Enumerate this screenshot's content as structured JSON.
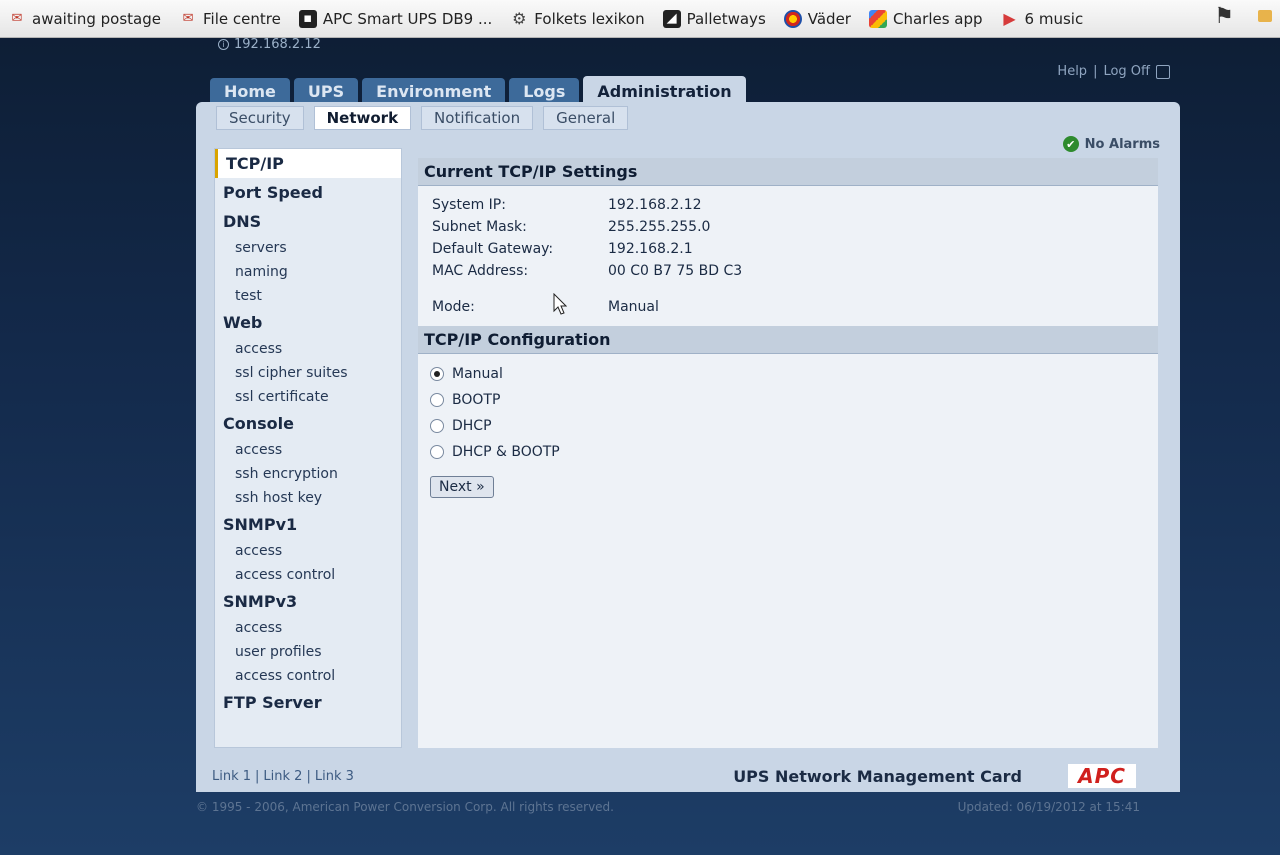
{
  "bookmarks": [
    {
      "label": "awaiting postage",
      "icon": "ebay-icon"
    },
    {
      "label": "File centre",
      "icon": "ebay-icon"
    },
    {
      "label": "APC Smart UPS DB9 ...",
      "icon": "apc-icon"
    },
    {
      "label": "Folkets lexikon",
      "icon": "gear-icon"
    },
    {
      "label": "Palletways",
      "icon": "palletways-icon"
    },
    {
      "label": "Väder",
      "icon": "sun-icon"
    },
    {
      "label": "Charles app",
      "icon": "google-icon"
    },
    {
      "label": "6 music",
      "icon": "play-icon"
    }
  ],
  "header": {
    "ip": "192.168.2.12",
    "help": "Help",
    "separator": "|",
    "logoff": "Log Off"
  },
  "main_tabs": [
    {
      "label": "Home"
    },
    {
      "label": "UPS"
    },
    {
      "label": "Environment"
    },
    {
      "label": "Logs"
    },
    {
      "label": "Administration",
      "active": true
    }
  ],
  "sub_tabs": [
    {
      "label": "Security"
    },
    {
      "label": "Network",
      "active": true
    },
    {
      "label": "Notification"
    },
    {
      "label": "General"
    }
  ],
  "status": {
    "alarms": "No Alarms"
  },
  "sidenav": [
    {
      "label": "TCP/IP",
      "level": 1,
      "current": true
    },
    {
      "label": "Port Speed",
      "level": 1
    },
    {
      "label": "DNS",
      "level": 1
    },
    {
      "label": "servers",
      "level": 2
    },
    {
      "label": "naming",
      "level": 2
    },
    {
      "label": "test",
      "level": 2
    },
    {
      "label": "Web",
      "level": 1
    },
    {
      "label": "access",
      "level": 2
    },
    {
      "label": "ssl cipher suites",
      "level": 2
    },
    {
      "label": "ssl certificate",
      "level": 2
    },
    {
      "label": "Console",
      "level": 1
    },
    {
      "label": "access",
      "level": 2
    },
    {
      "label": "ssh encryption",
      "level": 2
    },
    {
      "label": "ssh host key",
      "level": 2
    },
    {
      "label": "SNMPv1",
      "level": 1
    },
    {
      "label": "access",
      "level": 2
    },
    {
      "label": "access control",
      "level": 2
    },
    {
      "label": "SNMPv3",
      "level": 1
    },
    {
      "label": "access",
      "level": 2
    },
    {
      "label": "user profiles",
      "level": 2
    },
    {
      "label": "access control",
      "level": 2
    },
    {
      "label": "FTP Server",
      "level": 1
    }
  ],
  "current_settings": {
    "title": "Current TCP/IP Settings",
    "system_ip_label": "System IP:",
    "system_ip": "192.168.2.12",
    "subnet_label": "Subnet Mask:",
    "subnet": "255.255.255.0",
    "gateway_label": "Default Gateway:",
    "gateway": "192.168.2.1",
    "mac_label": "MAC Address:",
    "mac": "00 C0 B7 75 BD C3",
    "mode_label": "Mode:",
    "mode": "Manual"
  },
  "configuration": {
    "title": "TCP/IP Configuration",
    "options": [
      {
        "label": "Manual",
        "checked": true
      },
      {
        "label": "BOOTP",
        "checked": false
      },
      {
        "label": "DHCP",
        "checked": false
      },
      {
        "label": "DHCP & BOOTP",
        "checked": false
      }
    ],
    "next_label": "Next »"
  },
  "footer": {
    "link1": "Link 1",
    "link2": "Link 2",
    "link3": "Link 3",
    "sep": "|",
    "card_title": "UPS Network Management Card",
    "logo": "APC",
    "copyright": "© 1995 - 2006, American Power Conversion Corp. All rights reserved.",
    "updated": "Updated: 06/19/2012 at 15:41"
  }
}
